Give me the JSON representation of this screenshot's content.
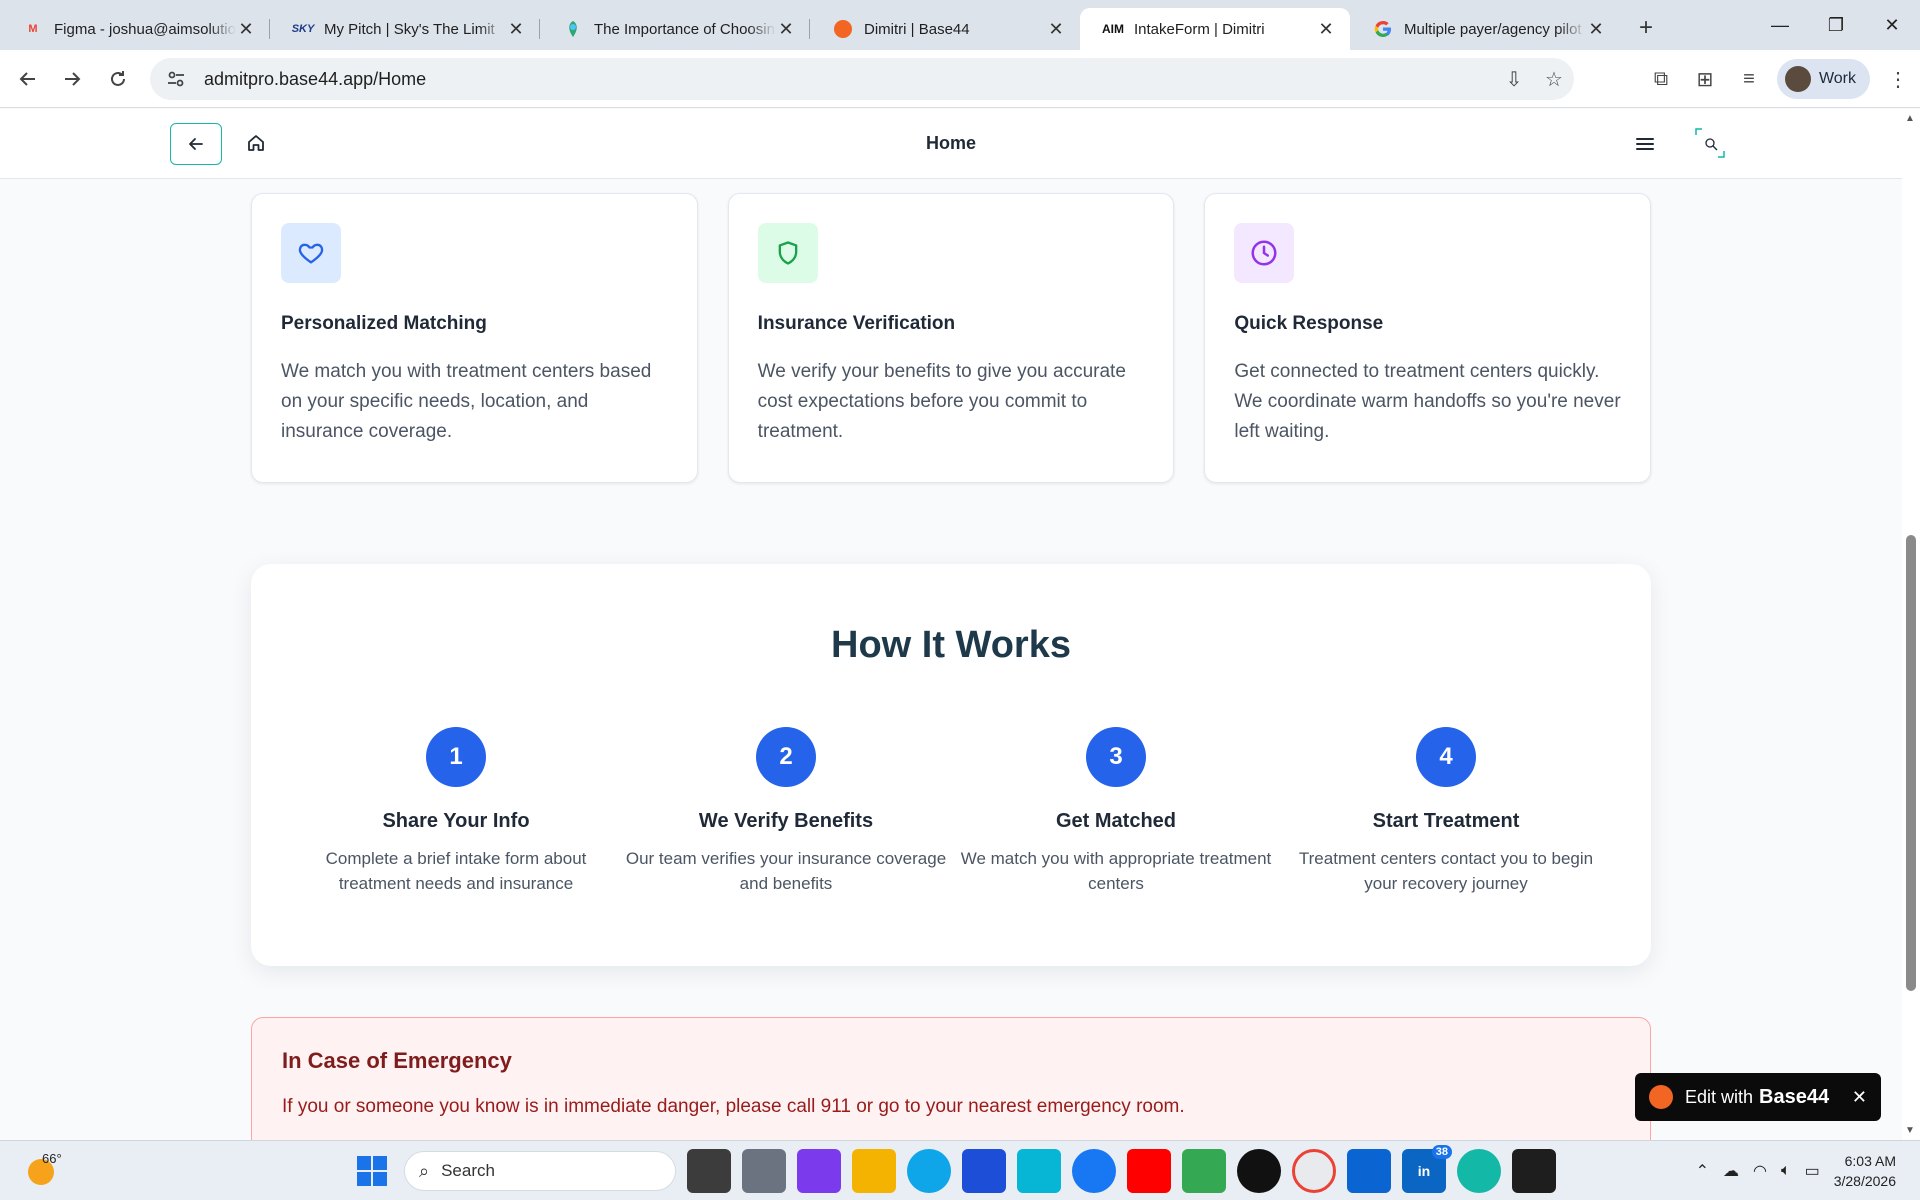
{
  "browser": {
    "tabs": [
      {
        "title": "Figma - joshua@aimsolutions",
        "favicon": "gmail-icon",
        "active": false
      },
      {
        "title": "My Pitch | Sky's The Limit",
        "favicon": "sky-icon",
        "active": false
      },
      {
        "title": "The Importance of Choosing",
        "favicon": "globe-icon",
        "active": false
      },
      {
        "title": "Dimitri | Base44",
        "favicon": "base44-icon",
        "active": false
      },
      {
        "title": "IntakeForm | Dimitri",
        "favicon": "aim-icon",
        "active": true
      },
      {
        "title": "Multiple payer/agency pilot",
        "favicon": "google-icon",
        "active": false
      }
    ],
    "url": "admitpro.base44.app/Home",
    "profile_label": "Work"
  },
  "header": {
    "title": "Home"
  },
  "features": [
    {
      "icon": "heart-icon",
      "icon_color": "#2563eb",
      "icon_bg": "#dbeafe",
      "title": "Personalized Matching",
      "description": "We match you with treatment centers based on your specific needs, location, and insurance coverage."
    },
    {
      "icon": "shield-icon",
      "icon_color": "#16a34a",
      "icon_bg": "#dcfce7",
      "title": "Insurance Verification",
      "description": "We verify your benefits to give you accurate cost expectations before you commit to treatment."
    },
    {
      "icon": "clock-icon",
      "icon_color": "#9333ea",
      "icon_bg": "#f3e8ff",
      "title": "Quick Response",
      "description": "Get connected to treatment centers quickly. We coordinate warm handoffs so you're never left waiting."
    }
  ],
  "how_it_works": {
    "heading": "How It Works",
    "accent": "#2563eb",
    "steps": [
      {
        "number": "1",
        "title": "Share Your Info",
        "description": "Complete a brief intake form about treatment needs and insurance"
      },
      {
        "number": "2",
        "title": "We Verify Benefits",
        "description": "Our team verifies your insurance coverage and benefits"
      },
      {
        "number": "3",
        "title": "Get Matched",
        "description": "We match you with appropriate treatment centers"
      },
      {
        "number": "4",
        "title": "Start Treatment",
        "description": "Treatment centers contact you to begin your recovery journey"
      }
    ]
  },
  "emergency": {
    "title": "In Case of Emergency",
    "text": "If you or someone you know is in immediate danger, please call 911 or go to your nearest emergency room."
  },
  "edit_badge": {
    "label": "Edit with",
    "brand": "Base44"
  },
  "taskbar": {
    "temperature": "66°",
    "search_placeholder": "Search",
    "linkedin_badge": "38",
    "time": "6:03 AM",
    "date": "3/28/2026"
  }
}
